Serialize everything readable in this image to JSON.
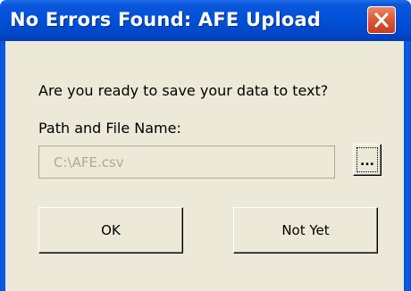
{
  "window": {
    "title": "No Errors Found: AFE Upload",
    "close_icon": "close-icon"
  },
  "dialog": {
    "question": "Are you ready to save your data to text?",
    "path_label": "Path and File Name:",
    "path_value": "C:\\AFE.csv",
    "browse_label": "...",
    "ok_label": "OK",
    "not_yet_label": "Not Yet"
  },
  "colors": {
    "titlebar": "#0052d8",
    "close_button": "#db5a3a",
    "dialog_background": "#ece9d8",
    "disabled_text": "#acaa99"
  }
}
